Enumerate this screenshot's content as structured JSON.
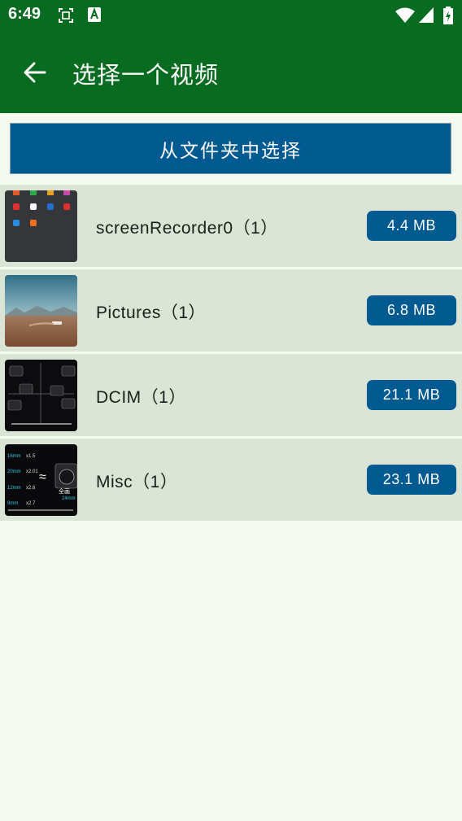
{
  "status": {
    "time": "6:49",
    "left_icons": [
      "screenshot-icon",
      "a-notification-icon"
    ],
    "right_icons": [
      "wifi-icon",
      "signal-icon",
      "battery-charging-icon"
    ]
  },
  "header": {
    "back_icon": "arrow-left-icon",
    "title": "选择一个视频"
  },
  "actions": {
    "select_folder_label": "从文件夹中选择"
  },
  "folders": [
    {
      "name": "screenRecorder0（1）",
      "size": "4.4 MB",
      "thumb": "screenshot-thumbnail"
    },
    {
      "name": "Pictures（1）",
      "size": "6.8 MB",
      "thumb": "landscape-thumbnail"
    },
    {
      "name": "DCIM（1）",
      "size": "21.1 MB",
      "thumb": "cameras-thumbnail"
    },
    {
      "name": "Misc（1）",
      "size": "23.1 MB",
      "thumb": "lens-chart-thumbnail"
    }
  ],
  "thumbnails": {
    "misc": {
      "line1": "16mm",
      "mult1": "x1.5",
      "line2": "20mm",
      "mult2": "x2.01",
      "line3": "12mm",
      "mult3": "x2.6",
      "line4": "9mm",
      "mult4": "x2.7",
      "approx": "≈",
      "right_label": "全画",
      "right_sub": "24mm"
    }
  },
  "colors": {
    "header_bg": "#076b20",
    "primary_button": "#005a92",
    "row_bg": "#dbe5d5",
    "page_bg": "#f3f9ee"
  }
}
